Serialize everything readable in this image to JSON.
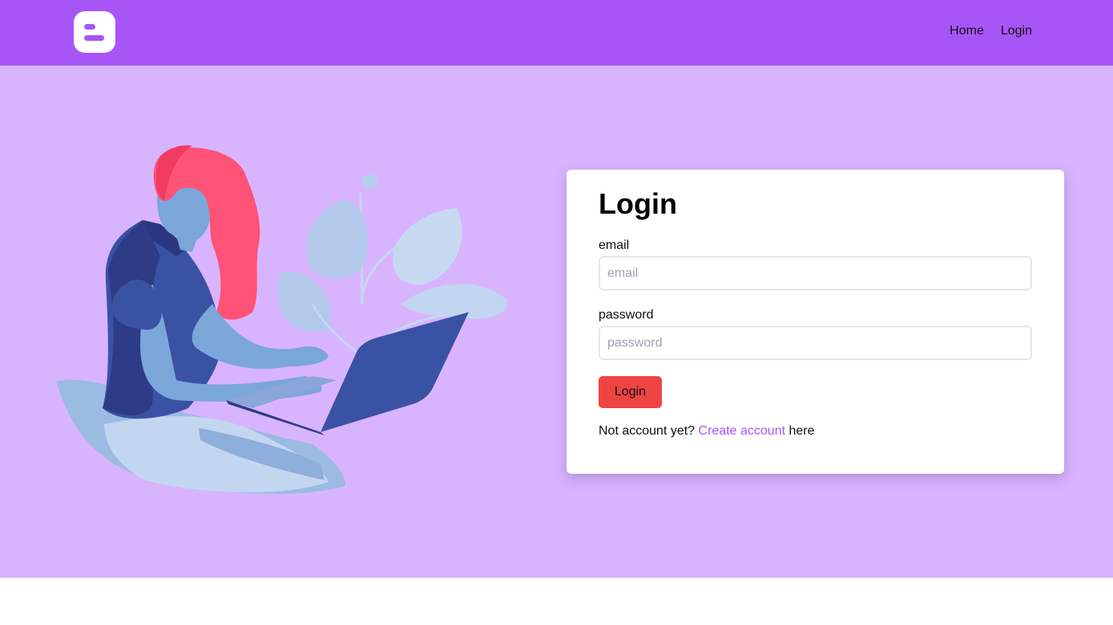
{
  "navbar": {
    "logo_icon": "blogger-logo-icon",
    "links": [
      {
        "label": "Home"
      },
      {
        "label": "Login"
      }
    ]
  },
  "illustration": {
    "icon": "woman-with-laptop-illustration"
  },
  "login_form": {
    "title": "Login",
    "email_label": "email",
    "email_placeholder": "email",
    "email_value": "",
    "password_label": "password",
    "password_placeholder": "password",
    "password_value": "",
    "submit_label": "Login",
    "signup_prefix": "Not account yet?",
    "signup_link": "Create account",
    "signup_suffix": "here"
  },
  "colors": {
    "navbar": "#a855f7",
    "hero_background": "#d8b4fe",
    "button": "#ef4444",
    "link": "#a855f7"
  }
}
